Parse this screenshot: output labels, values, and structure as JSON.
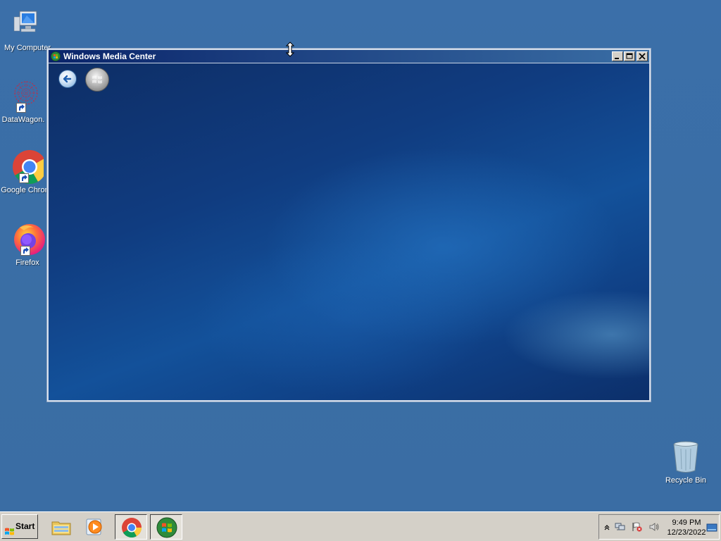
{
  "desktop": {
    "icons": [
      {
        "label": "My Computer",
        "icon": "monitor-icon"
      },
      {
        "label": "DataWagon.",
        "icon": "datawagon-icon"
      },
      {
        "label": "Google Chrom",
        "icon": "chrome-icon"
      },
      {
        "label": "Firefox",
        "icon": "firefox-icon"
      },
      {
        "label": "Recycle Bin",
        "icon": "recycle-bin-icon"
      }
    ]
  },
  "window": {
    "title": "Windows Media Center",
    "controls": [
      "minimize",
      "maximize",
      "close"
    ]
  },
  "taskbar": {
    "start_label": "Start",
    "pinned": [
      "explorer-icon",
      "media-player-icon",
      "chrome-icon",
      "media-center-icon"
    ],
    "clock": {
      "time": "9:49 PM",
      "date": "12/23/2022"
    }
  },
  "colors": {
    "desktop": "#3a6ea5",
    "titlebar_start": "#0a246a",
    "titlebar_end": "#3a6ea5",
    "taskbar": "#d4d0c8"
  }
}
